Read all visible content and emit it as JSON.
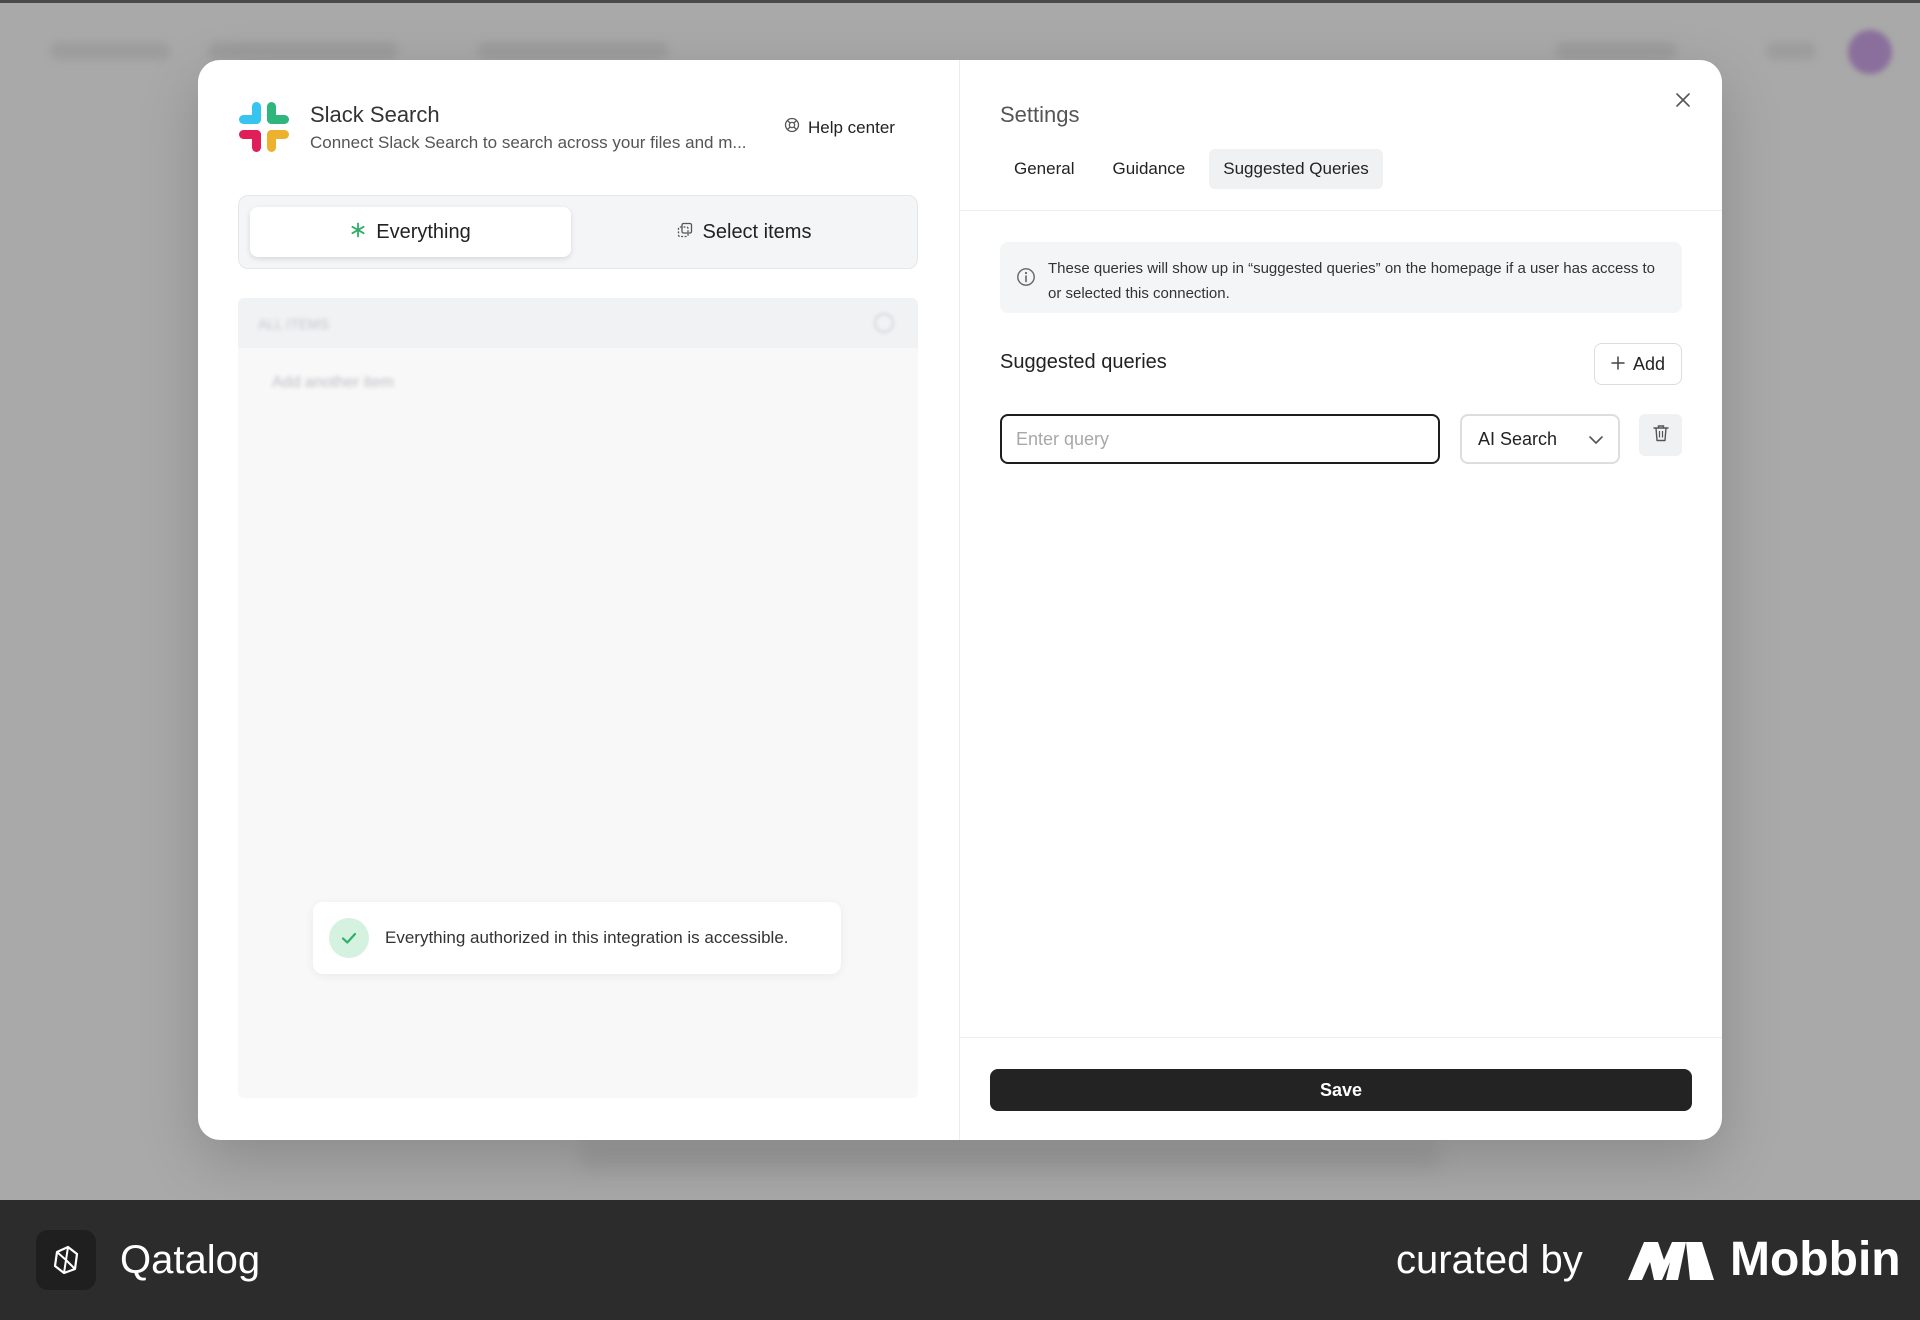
{
  "integration": {
    "title": "Slack Search",
    "description": "Connect Slack Search to search across your files and m...",
    "help_label": "Help center"
  },
  "mode_switch": {
    "everything_label": "Everything",
    "select_items_label": "Select items",
    "selected": "Everything"
  },
  "toast": {
    "message": "Everything authorized in this integration is accessible."
  },
  "settings": {
    "title": "Settings",
    "tabs": [
      {
        "label": "General"
      },
      {
        "label": "Guidance"
      },
      {
        "label": "Suggested Queries"
      }
    ],
    "active_tab": "Suggested Queries",
    "info_text": "These queries will show up in “suggested queries” on the homepage if a user has access to or selected this connection.",
    "suggested_queries_label": "Suggested queries",
    "add_label": "Add",
    "query_row": {
      "value": "",
      "placeholder": "Enter query",
      "type_selected": "AI Search"
    },
    "save_label": "Save"
  },
  "branding": {
    "app_name": "Qatalog",
    "curated_label": "curated by",
    "curator_name": "Mobbin"
  },
  "icons": {
    "help": "help-circle-icon",
    "everything": "asterisk-icon",
    "select_items": "select-items-icon",
    "check": "check-icon",
    "close": "close-icon",
    "info": "info-icon",
    "add": "plus-icon",
    "dropdown": "chevron-down-icon",
    "delete": "trash-icon"
  },
  "colors": {
    "accent_green": "#2fae68",
    "save_button": "#232323",
    "overlay": "#a6a6a6"
  }
}
